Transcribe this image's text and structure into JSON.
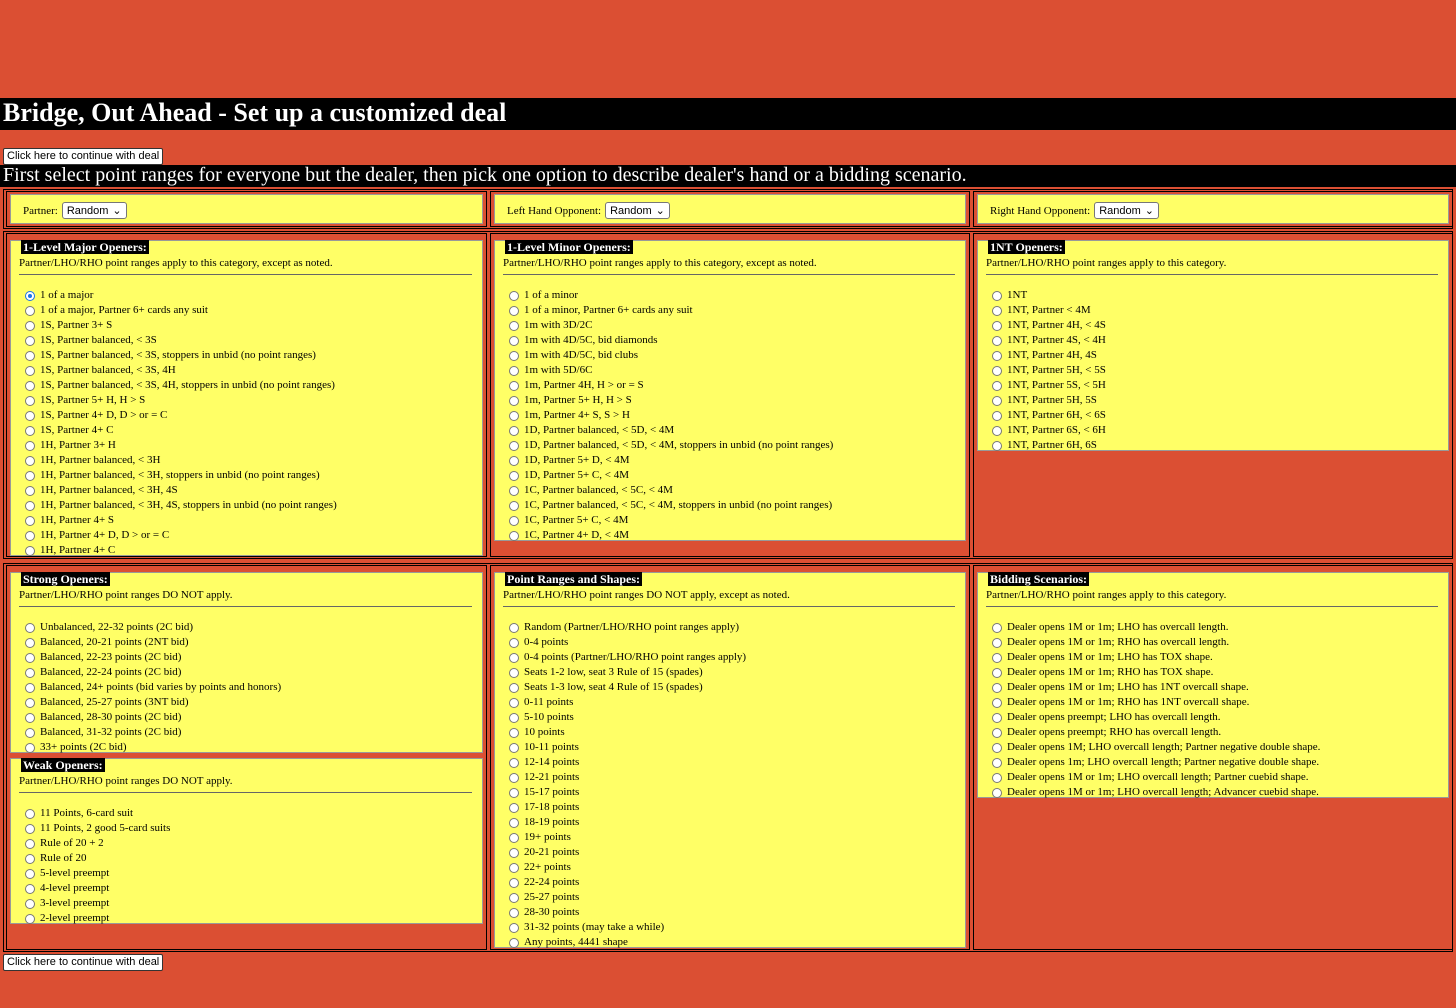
{
  "page": {
    "title": "Bridge, Out Ahead - Set up a customized deal",
    "continue_label": "Click here to continue with deal",
    "instructions": "First select point ranges for everyone but the dealer, then pick one option to describe dealer's hand or a bidding scenario."
  },
  "players": {
    "partner": {
      "label": "Partner:",
      "value": "Random"
    },
    "lho": {
      "label": "Left Hand Opponent:",
      "value": "Random"
    },
    "rho": {
      "label": "Right Hand Opponent:",
      "value": "Random"
    }
  },
  "sections": {
    "major": {
      "legend": "1-Level Major Openers:",
      "note": "Partner/LHO/RHO point ranges apply to this category, except as noted.",
      "selected_index": 0,
      "options": [
        "1 of a major",
        "1 of a major, Partner 6+ cards any suit",
        "1S, Partner 3+ S",
        "1S, Partner balanced, < 3S",
        "1S, Partner balanced, < 3S, stoppers in unbid (no point ranges)",
        "1S, Partner balanced, < 3S, 4H",
        "1S, Partner balanced, < 3S, 4H, stoppers in unbid (no point ranges)",
        "1S, Partner 5+ H, H > S",
        "1S, Partner 4+ D, D > or = C",
        "1S, Partner 4+ C",
        "1H, Partner 3+ H",
        "1H, Partner balanced, < 3H",
        "1H, Partner balanced, < 3H, stoppers in unbid (no point ranges)",
        "1H, Partner balanced, < 3H, 4S",
        "1H, Partner balanced, < 3H, 4S, stoppers in unbid (no point ranges)",
        "1H, Partner 4+ S",
        "1H, Partner 4+ D, D > or = C",
        "1H, Partner 4+ C"
      ]
    },
    "minor": {
      "legend": "1-Level Minor Openers:",
      "note": "Partner/LHO/RHO point ranges apply to this category, except as noted.",
      "options": [
        "1 of a minor",
        "1 of a minor, Partner 6+ cards any suit",
        "1m with 3D/2C",
        "1m with 4D/5C, bid diamonds",
        "1m with 4D/5C, bid clubs",
        "1m with 5D/6C",
        "1m, Partner 4H, H > or = S",
        "1m, Partner 5+ H, H > S",
        "1m, Partner 4+ S, S > H",
        "1D, Partner balanced, < 5D, < 4M",
        "1D, Partner balanced, < 5D, < 4M, stoppers in unbid (no point ranges)",
        "1D, Partner 5+ D, < 4M",
        "1D, Partner 5+ C, < 4M",
        "1C, Partner balanced, < 5C, < 4M",
        "1C, Partner balanced, < 5C, < 4M, stoppers in unbid (no point ranges)",
        "1C, Partner 5+ C, < 4M",
        "1C, Partner 4+ D, < 4M"
      ]
    },
    "nt": {
      "legend": "1NT Openers:",
      "note": "Partner/LHO/RHO point ranges apply to this category.",
      "options": [
        "1NT",
        "1NT, Partner < 4M",
        "1NT, Partner 4H, < 4S",
        "1NT, Partner 4S, < 4H",
        "1NT, Partner 4H, 4S",
        "1NT, Partner 5H, < 5S",
        "1NT, Partner 5S, < 5H",
        "1NT, Partner 5H, 5S",
        "1NT, Partner 6H, < 6S",
        "1NT, Partner 6S, < 6H",
        "1NT, Partner 6H, 6S"
      ]
    },
    "strong": {
      "legend": "Strong Openers:",
      "note": "Partner/LHO/RHO point ranges DO NOT apply.",
      "options": [
        "Unbalanced, 22-32 points (2C bid)",
        "Balanced, 20-21 points (2NT bid)",
        "Balanced, 22-23 points (2C bid)",
        "Balanced, 22-24 points (2C bid)",
        "Balanced, 24+ points (bid varies by points and honors)",
        "Balanced, 25-27 points (3NT bid)",
        "Balanced, 28-30 points (2C bid)",
        "Balanced, 31-32 points (2C bid)",
        "33+ points (2C bid)"
      ]
    },
    "weak": {
      "legend": "Weak Openers:",
      "note": "Partner/LHO/RHO point ranges DO NOT apply.",
      "options": [
        "11 Points, 6-card suit",
        "11 Points, 2 good 5-card suits",
        "Rule of 20 + 2",
        "Rule of 20",
        "5-level preempt",
        "4-level preempt",
        "3-level preempt",
        "2-level preempt"
      ]
    },
    "ranges": {
      "legend": "Point Ranges and Shapes:",
      "note": "Partner/LHO/RHO point ranges DO NOT apply, except as noted.",
      "options": [
        "Random (Partner/LHO/RHO point ranges apply)",
        "0-4 points",
        "0-4 points (Partner/LHO/RHO point ranges apply)",
        "Seats 1-2 low, seat 3 Rule of 15 (spades)",
        "Seats 1-3 low, seat 4 Rule of 15 (spades)",
        "0-11 points",
        "5-10 points",
        "10 points",
        "10-11 points",
        "12-14 points",
        "12-21 points",
        "15-17 points",
        "17-18 points",
        "18-19 points",
        "19+ points",
        "20-21 points",
        "22+ points",
        "22-24 points",
        "25-27 points",
        "28-30 points",
        "31-32 points (may take a while)",
        "Any points, 4441 shape"
      ]
    },
    "bidding": {
      "legend": "Bidding Scenarios:",
      "note": "Partner/LHO/RHO point ranges apply to this category.",
      "options": [
        "Dealer opens 1M or 1m; LHO has overcall length.",
        "Dealer opens 1M or 1m; RHO has overcall length.",
        "Dealer opens 1M or 1m; LHO has TOX shape.",
        "Dealer opens 1M or 1m; RHO has TOX shape.",
        "Dealer opens 1M or 1m; LHO has 1NT overcall shape.",
        "Dealer opens 1M or 1m; RHO has 1NT overcall shape.",
        "Dealer opens preempt; LHO has overcall length.",
        "Dealer opens preempt; RHO has overcall length.",
        "Dealer opens 1M; LHO overcall length; Partner negative double shape.",
        "Dealer opens 1m; LHO overcall length; Partner negative double shape.",
        "Dealer opens 1M or 1m; LHO overcall length; Partner cuebid shape.",
        "Dealer opens 1M or 1m; LHO overcall length; Advancer cuebid shape."
      ]
    }
  }
}
